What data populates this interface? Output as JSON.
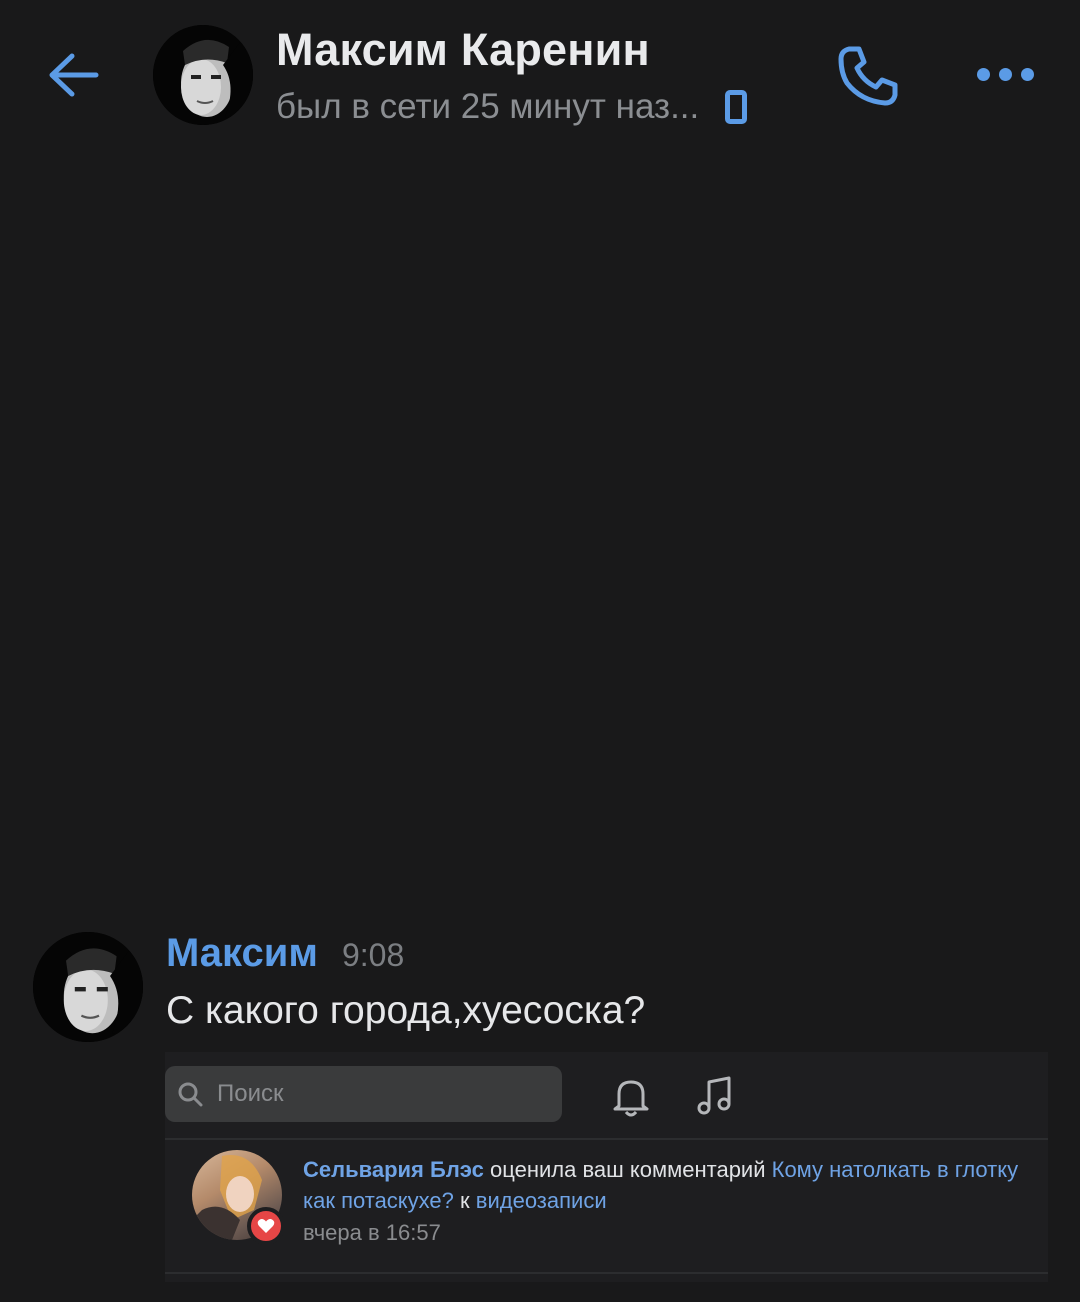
{
  "header": {
    "contact_name": "Максим Каренин",
    "status": "был в сети 25 минут наз...",
    "status_device_icon": "mobile-phone-icon",
    "back_icon": "arrow-left-icon",
    "call_icon": "phone-icon",
    "more_icon": "more-dots-icon"
  },
  "message": {
    "sender": "Максим",
    "time": "9:08",
    "text": "С какого города,хуесоска?"
  },
  "attachment": {
    "search_placeholder": "Поиск",
    "notification": {
      "actor": "Сельвария Блэс",
      "action": " оценила ваш комментарий ",
      "comment_link": "Кому натолкать в глотку как потаскухе?",
      "connector": " к ",
      "target_link": "видеозаписи",
      "time": "вчера в 16:57"
    }
  },
  "colors": {
    "background": "#19191a",
    "accent": "#5b9be6",
    "secondary_text": "#8b8e92",
    "like_red": "#e64646"
  }
}
